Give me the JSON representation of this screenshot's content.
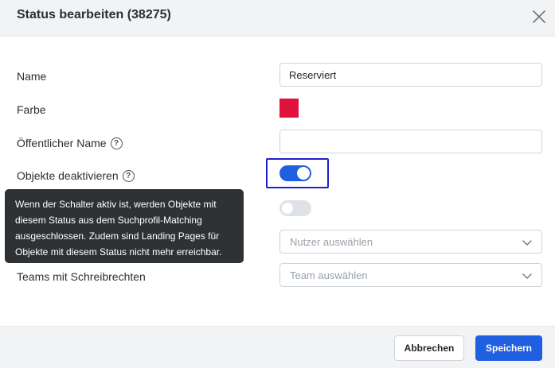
{
  "header": {
    "title": "Status bearbeiten (38275)"
  },
  "form": {
    "name_label": "Name",
    "name_value": "Reserviert",
    "color_label": "Farbe",
    "color_value": "#e0123c",
    "public_name_label": "Öffentlicher Name",
    "public_name_value": "",
    "deactivate_label": "Objekte deaktivieren",
    "deactivate_on": true,
    "second_toggle_on": false,
    "users_placeholder": "Nutzer auswählen",
    "teams_label": "Teams mit Schreibrechten",
    "teams_placeholder": "Team auswählen"
  },
  "tooltip": {
    "lines": [
      "Wenn der Schalter aktiv ist, werden Objekte mit",
      "diesem Status aus dem Suchprofil-Matching",
      "ausgeschlossen. Zudem sind Landing Pages für",
      "Objekte mit diesem Status nicht mehr erreichbar."
    ]
  },
  "footer": {
    "cancel_label": "Abbrechen",
    "save_label": "Speichern"
  },
  "colors": {
    "primary": "#1f5fe0",
    "focus": "#1f1fd1",
    "swatch": "#e0123c"
  },
  "icons": [
    "close-icon",
    "help-icon",
    "chevron-down-icon"
  ]
}
